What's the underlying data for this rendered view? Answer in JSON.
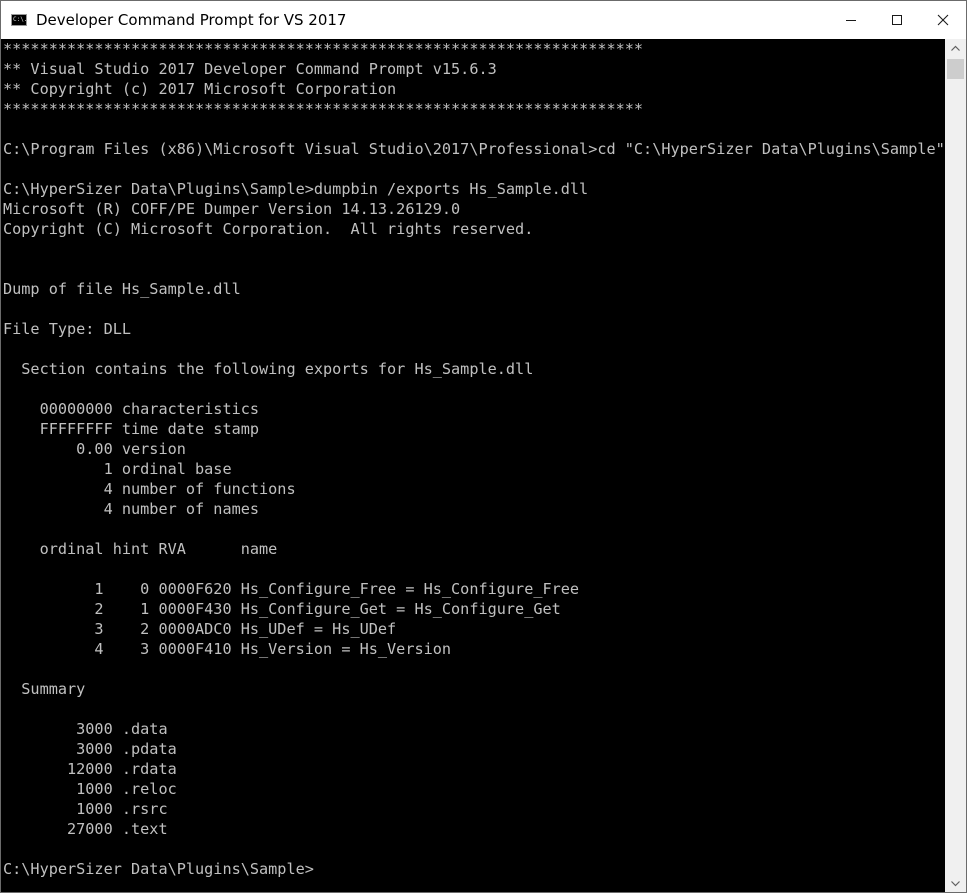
{
  "window": {
    "title": "Developer Command Prompt for VS 2017",
    "app_icon_glyph": "C:\\.",
    "icons": {
      "app": "console-app-icon",
      "minimize": "minimize-icon",
      "maximize": "maximize-icon",
      "close": "close-icon"
    }
  },
  "console": {
    "foreground": "#c0c0c0",
    "background": "#000000",
    "lines": [
      "**********************************************************************",
      "** Visual Studio 2017 Developer Command Prompt v15.6.3",
      "** Copyright (c) 2017 Microsoft Corporation",
      "**********************************************************************",
      "",
      "C:\\Program Files (x86)\\Microsoft Visual Studio\\2017\\Professional>cd \"C:\\HyperSizer Data\\Plugins\\Sample\"",
      "",
      "C:\\HyperSizer Data\\Plugins\\Sample>dumpbin /exports Hs_Sample.dll",
      "Microsoft (R) COFF/PE Dumper Version 14.13.26129.0",
      "Copyright (C) Microsoft Corporation.  All rights reserved.",
      "",
      "",
      "Dump of file Hs_Sample.dll",
      "",
      "File Type: DLL",
      "",
      "  Section contains the following exports for Hs_Sample.dll",
      "",
      "    00000000 characteristics",
      "    FFFFFFFF time date stamp",
      "        0.00 version",
      "           1 ordinal base",
      "           4 number of functions",
      "           4 number of names",
      "",
      "    ordinal hint RVA      name",
      "",
      "          1    0 0000F620 Hs_Configure_Free = Hs_Configure_Free",
      "          2    1 0000F430 Hs_Configure_Get = Hs_Configure_Get",
      "          3    2 0000ADC0 Hs_UDef = Hs_UDef",
      "          4    3 0000F410 Hs_Version = Hs_Version",
      "",
      "  Summary",
      "",
      "        3000 .data",
      "        3000 .pdata",
      "       12000 .rdata",
      "        1000 .reloc",
      "        1000 .rsrc",
      "       27000 .text",
      "",
      "C:\\HyperSizer Data\\Plugins\\Sample>"
    ]
  },
  "scrollbar": {
    "up_icon": "scroll-up-arrow-icon",
    "down_icon": "scroll-down-arrow-icon"
  }
}
